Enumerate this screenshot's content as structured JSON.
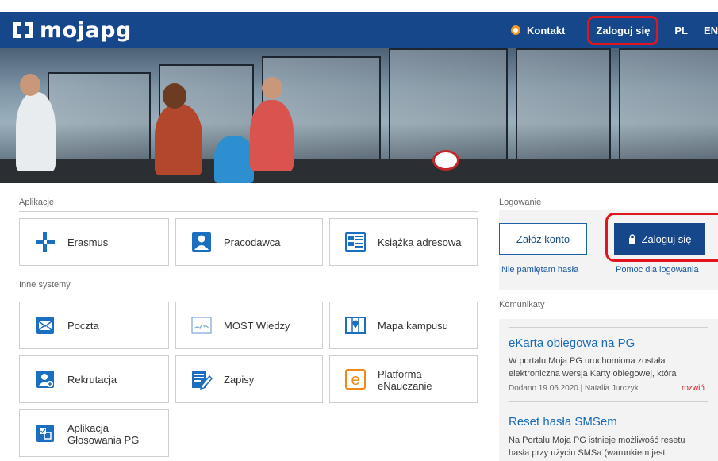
{
  "header": {
    "logo_text": "mojapg",
    "nav": {
      "contact": "Kontakt",
      "login": "Zaloguj się",
      "lang_pl": "PL",
      "lang_en": "EN"
    }
  },
  "apps": {
    "section_label": "Aplikacje",
    "tiles": [
      {
        "label": "Erasmus",
        "icon": "erasmus-icon"
      },
      {
        "label": "Pracodawca",
        "icon": "employer-icon"
      },
      {
        "label": "Książka adresowa",
        "icon": "address-book-icon"
      }
    ]
  },
  "other_systems": {
    "section_label": "Inne systemy",
    "tiles": [
      {
        "label": "Poczta",
        "icon": "mail-icon"
      },
      {
        "label": "MOST Wiedzy",
        "icon": "most-wiedzy-icon"
      },
      {
        "label": "Mapa kampusu",
        "icon": "campus-map-icon"
      },
      {
        "label": "Rekrutacja",
        "icon": "recruitment-icon"
      },
      {
        "label": "Zapisy",
        "icon": "enrollment-icon"
      },
      {
        "label_line1": "Platforma",
        "label_line2": "eNauczanie",
        "icon": "elearning-icon"
      },
      {
        "label_line1": "Aplikacja",
        "label_line2": "Głosowania PG",
        "icon": "voting-app-icon"
      }
    ]
  },
  "login": {
    "section_label": "Logowanie",
    "register_label": "Załóż konto",
    "login_label": "Zaloguj się",
    "forgot_password": "Nie pamiętam hasła",
    "login_help": "Pomoc dla logowania"
  },
  "news": {
    "section_label": "Komunikaty",
    "items": [
      {
        "title": "eKarta obiegowa na PG",
        "body_line1": "W portalu Moja PG uruchomiona została",
        "body_line2": "elektroniczna wersja Karty obiegowej, która",
        "meta": "Dodano 19.06.2020 | Natalia Jurczyk",
        "more": "rozwiń"
      },
      {
        "title": "Reset hasła SMSem",
        "body_line1": "Na Portalu Moja PG istnieje możliwość resetu",
        "body_line2": "hasła przy użyciu SMSa (warunkiem jest"
      }
    ]
  },
  "colors": {
    "brand_blue": "#16478a",
    "highlight_red": "#e2161f",
    "link_blue": "#1a57a0",
    "contact_orange": "#f39a1e"
  }
}
